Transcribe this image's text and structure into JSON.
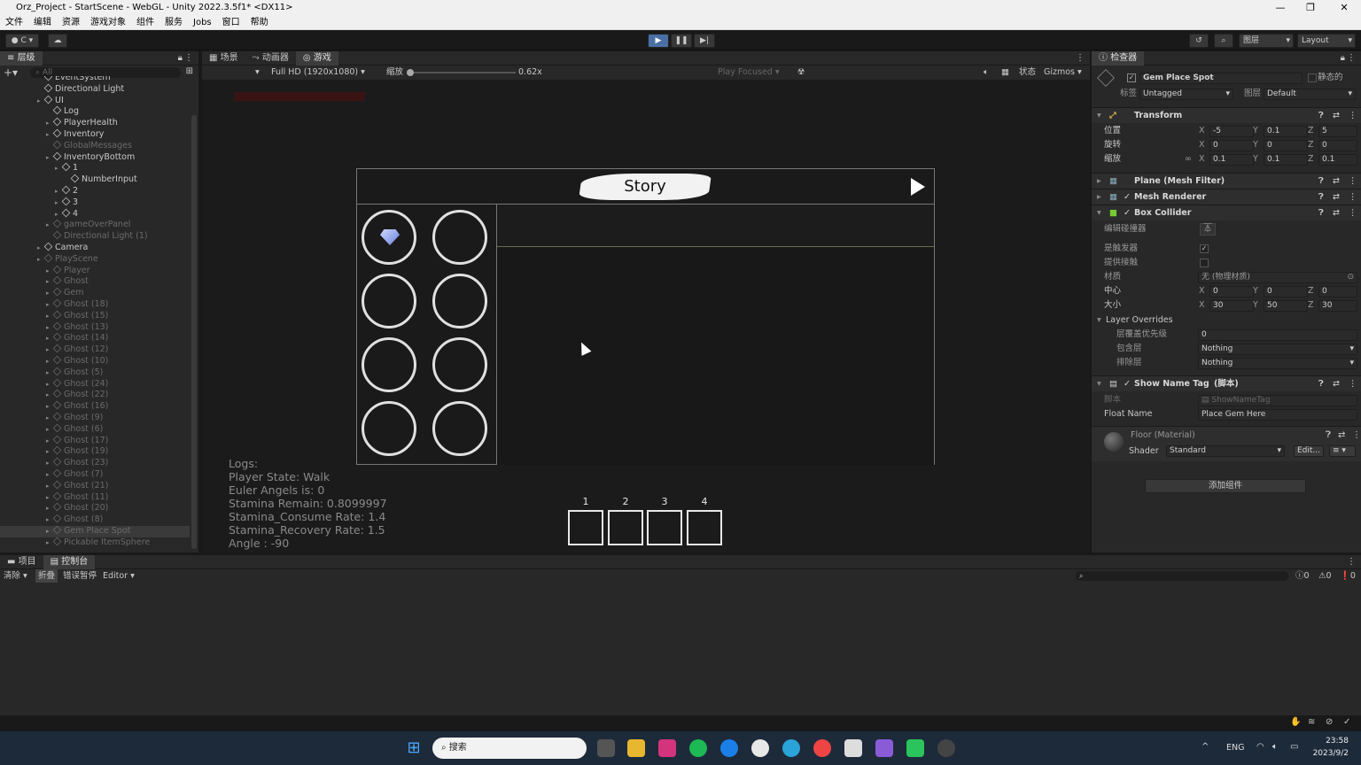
{
  "window": {
    "title": "Orz_Project - StartScene - WebGL - Unity 2022.3.5f1* <DX11>"
  },
  "menu": [
    "文件",
    "编辑",
    "资源",
    "游戏对象",
    "组件",
    "服务",
    "Jobs",
    "窗口",
    "帮助"
  ],
  "toolbar": {
    "account": "C",
    "layers": "图层",
    "layout": "Layout"
  },
  "hierarchy": {
    "tab": "层级",
    "search_placeholder": "All",
    "items": [
      {
        "label": "EventSystem",
        "indent": 4,
        "dim": false
      },
      {
        "label": "Directional Light",
        "indent": 4,
        "dim": false
      },
      {
        "label": "UI",
        "indent": 4,
        "dim": false,
        "arrow": true
      },
      {
        "label": "Log",
        "indent": 5,
        "dim": false
      },
      {
        "label": "PlayerHealth",
        "indent": 5,
        "dim": false,
        "arrow": true
      },
      {
        "label": "Inventory",
        "indent": 5,
        "dim": false,
        "arrow": true
      },
      {
        "label": "GlobalMessages",
        "indent": 5,
        "dim": true
      },
      {
        "label": "InventoryBottom",
        "indent": 5,
        "dim": false,
        "arrow": true
      },
      {
        "label": "1",
        "indent": 6,
        "dim": false,
        "arrow": true
      },
      {
        "label": "NumberInput",
        "indent": 7,
        "dim": false
      },
      {
        "label": "2",
        "indent": 6,
        "dim": false,
        "arrow": true
      },
      {
        "label": "3",
        "indent": 6,
        "dim": false,
        "arrow": true
      },
      {
        "label": "4",
        "indent": 6,
        "dim": false,
        "arrow": true
      },
      {
        "label": "gameOverPanel",
        "indent": 5,
        "dim": true,
        "arrow": true
      },
      {
        "label": "Directional Light (1)",
        "indent": 5,
        "dim": true
      },
      {
        "label": "Camera",
        "indent": 4,
        "dim": false,
        "arrow": true
      },
      {
        "label": "PlayScene",
        "indent": 4,
        "dim": true,
        "arrow": true
      },
      {
        "label": "Player",
        "indent": 5,
        "dim": true,
        "arrow": true
      },
      {
        "label": "Ghost",
        "indent": 5,
        "dim": true,
        "arrow": true
      },
      {
        "label": "Gem",
        "indent": 5,
        "dim": true,
        "arrow": true
      },
      {
        "label": "Ghost (18)",
        "indent": 5,
        "dim": true,
        "arrow": true
      },
      {
        "label": "Ghost (15)",
        "indent": 5,
        "dim": true,
        "arrow": true
      },
      {
        "label": "Ghost (13)",
        "indent": 5,
        "dim": true,
        "arrow": true
      },
      {
        "label": "Ghost (14)",
        "indent": 5,
        "dim": true,
        "arrow": true
      },
      {
        "label": "Ghost (12)",
        "indent": 5,
        "dim": true,
        "arrow": true
      },
      {
        "label": "Ghost (10)",
        "indent": 5,
        "dim": true,
        "arrow": true
      },
      {
        "label": "Ghost (5)",
        "indent": 5,
        "dim": true,
        "arrow": true
      },
      {
        "label": "Ghost (24)",
        "indent": 5,
        "dim": true,
        "arrow": true
      },
      {
        "label": "Ghost (22)",
        "indent": 5,
        "dim": true,
        "arrow": true
      },
      {
        "label": "Ghost (16)",
        "indent": 5,
        "dim": true,
        "arrow": true
      },
      {
        "label": "Ghost (9)",
        "indent": 5,
        "dim": true,
        "arrow": true
      },
      {
        "label": "Ghost (6)",
        "indent": 5,
        "dim": true,
        "arrow": true
      },
      {
        "label": "Ghost (17)",
        "indent": 5,
        "dim": true,
        "arrow": true
      },
      {
        "label": "Ghost (19)",
        "indent": 5,
        "dim": true,
        "arrow": true
      },
      {
        "label": "Ghost (23)",
        "indent": 5,
        "dim": true,
        "arrow": true
      },
      {
        "label": "Ghost (7)",
        "indent": 5,
        "dim": true,
        "arrow": true
      },
      {
        "label": "Ghost (21)",
        "indent": 5,
        "dim": true,
        "arrow": true
      },
      {
        "label": "Ghost (11)",
        "indent": 5,
        "dim": true,
        "arrow": true
      },
      {
        "label": "Ghost (20)",
        "indent": 5,
        "dim": true,
        "arrow": true
      },
      {
        "label": "Ghost (8)",
        "indent": 5,
        "dim": true,
        "arrow": true
      },
      {
        "label": "Gem Place Spot",
        "indent": 5,
        "dim": true,
        "arrow": true,
        "selected": true
      },
      {
        "label": "Pickable ItemSphere",
        "indent": 5,
        "dim": true,
        "arrow": true
      }
    ]
  },
  "center": {
    "tabs": [
      "场景",
      "动画器",
      "游戏"
    ],
    "resolution": "Full HD (1920x1080)",
    "scale_label": "缩放",
    "scale_value": "0.62x",
    "play_focused": "Play Focused",
    "stats": "状态",
    "gizmos": "Gizmos"
  },
  "game": {
    "story_title": "Story",
    "logs": [
      "Logs:",
      "Player State: Walk",
      "Euler Angels is: 0",
      "Stamina Remain: 0.8099997",
      "Stamina_Consume Rate: 1.4",
      "Stamina_Recovery Rate: 1.5",
      "Angle : -90"
    ],
    "slots": [
      "1",
      "2",
      "3",
      "4"
    ]
  },
  "inspector": {
    "tab": "检查器",
    "object_name": "Gem Place Spot",
    "static_label": "静态的",
    "tag_label": "标签",
    "tag_value": "Untagged",
    "layer_label": "图层",
    "layer_value": "Default",
    "transform": {
      "title": "Transform",
      "pos_label": "位置",
      "pos": [
        "-5",
        "0.1",
        "5"
      ],
      "rot_label": "旋转",
      "rot": [
        "0",
        "0",
        "0"
      ],
      "scale_label": "缩放",
      "scale": [
        "0.1",
        "0.1",
        "0.1"
      ]
    },
    "mesh_filter": "Plane (Mesh Filter)",
    "mesh_renderer": "Mesh Renderer",
    "box_collider": {
      "title": "Box Collider",
      "edit_label": "编辑碰撞器",
      "trigger_label": "是触发器",
      "contacts_label": "提供接触",
      "material_label": "材质",
      "material_value": "无 (物理材质)",
      "center_label": "中心",
      "center": [
        "0",
        "0",
        "0"
      ],
      "size_label": "大小",
      "size": [
        "30",
        "50",
        "30"
      ]
    },
    "layer_overrides": {
      "title": "Layer Overrides",
      "priority_label": "层覆盖优先级",
      "priority": "0",
      "include_label": "包含层",
      "include": "Nothing",
      "exclude_label": "排除层",
      "exclude": "Nothing"
    },
    "script": {
      "title": "Show Name Tag",
      "suffix": "(脚本)",
      "script_label": "脚本",
      "script_value": "ShowNameTag",
      "float_label": "Float Name",
      "float_value": "Place Gem Here"
    },
    "material": {
      "title": "Floor (Material)",
      "shader_label": "Shader",
      "shader_value": "Standard",
      "edit": "Edit..."
    },
    "add_component": "添加组件"
  },
  "console": {
    "tabs": [
      "项目",
      "控制台"
    ],
    "clear": "清除",
    "collapse": "折叠",
    "error_pause": "错误暂停",
    "editor": "Editor",
    "counts": [
      "0",
      "0",
      "0"
    ]
  },
  "taskbar": {
    "search": "搜索",
    "lang": "ENG",
    "time": "23:58",
    "date": "2023/9/2"
  },
  "colors": {
    "accent": "#3a7bd5",
    "panel": "#282828",
    "game_bg": "#1b1b1b"
  }
}
